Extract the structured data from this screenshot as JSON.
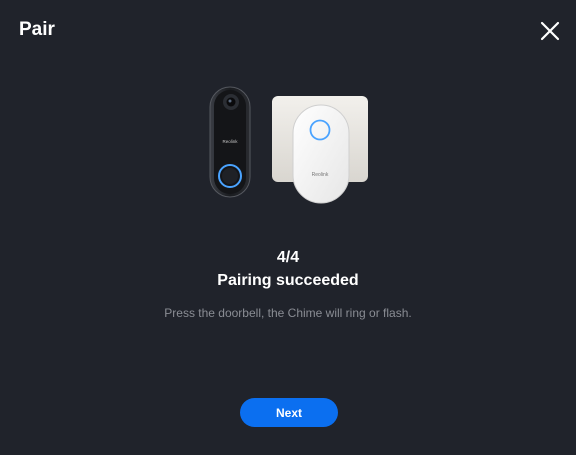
{
  "dialog": {
    "title": "Pair",
    "close_icon": "close-icon"
  },
  "illustration": {
    "doorbell_brand": "Reolink",
    "chime_brand": "Reolink",
    "accent_color": "#4aa3ff"
  },
  "progress": {
    "step": "4/4",
    "status": "Pairing succeeded",
    "hint": "Press the doorbell, the Chime will ring or flash."
  },
  "actions": {
    "next_label": "Next",
    "button_color": "#0b6ff0"
  }
}
